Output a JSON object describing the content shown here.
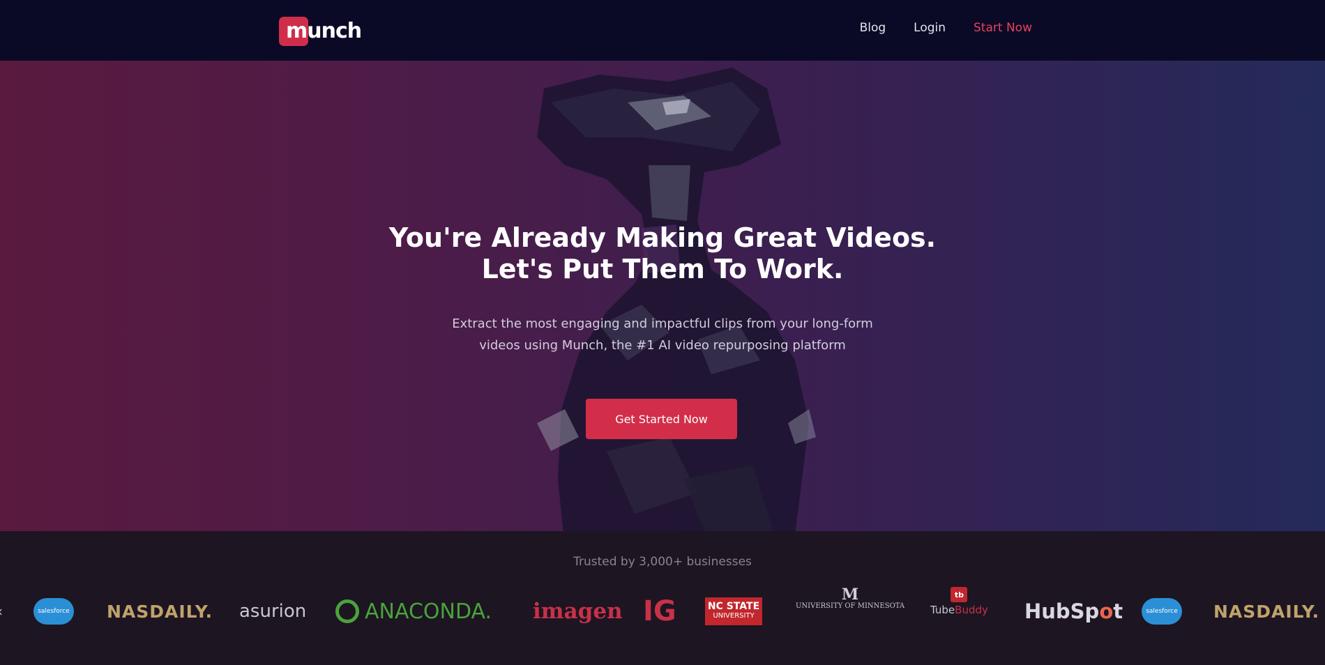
{
  "nav": {
    "logo_text": "munch",
    "links": [
      "Blog",
      "Login",
      "Start Now"
    ]
  },
  "hero": {
    "title_line1": "You're Already Making Great Videos.",
    "title_line2": "Let's Put Them To Work.",
    "subtitle_line1": "Extract the most engaging and impactful clips from your long-form",
    "subtitle_line2": "videos using Munch, the #1 AI video repurposing platform",
    "cta_label": "Get Started Now"
  },
  "trust": {
    "text": "Trusted by 3,000+ businesses",
    "logos": {
      "salesforce": "salesforce",
      "nasdaily": "NASDAILY.",
      "asurion": "asurion",
      "anaconda": "ANACONDA.",
      "imagen": "imagen",
      "ig": "IG",
      "ncstate_line1": "NC STATE",
      "ncstate_line2": "UNIVERSITY",
      "umn_mark": "M",
      "umn": "UNIVERSITY OF MINNESOTA",
      "tubebuddy_mark": "tb",
      "tubebuddy_a": "Tube",
      "tubebuddy_b": "Buddy",
      "hubspot_a": "HubSp",
      "hubspot_o": "o",
      "hubspot_b": "t"
    }
  },
  "colors": {
    "nav_bg": "#0b0a26",
    "accent": "#d22e49",
    "hero_left": "#5a1a3f",
    "hero_right": "#242a5a",
    "trust_bg": "#1d1522"
  }
}
